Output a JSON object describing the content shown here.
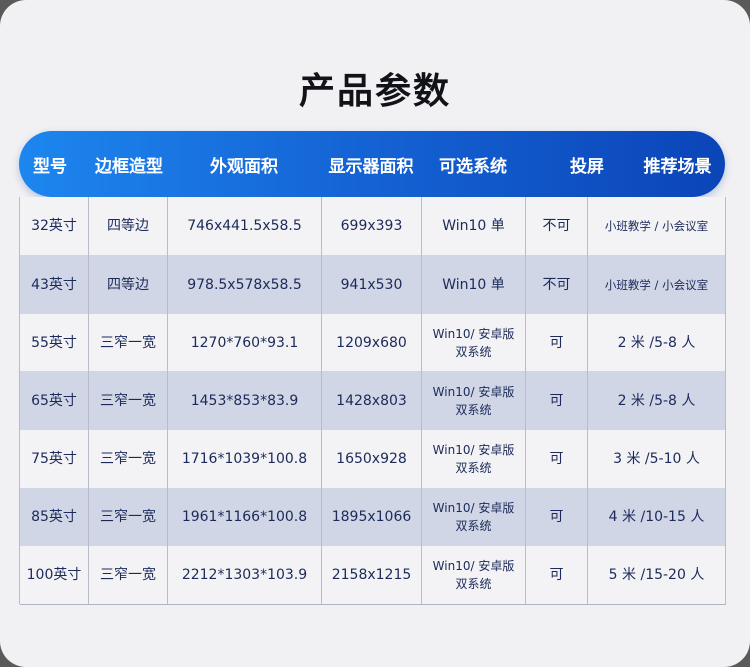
{
  "title": "产品参数",
  "header": {
    "columns": [
      "型号",
      "边框造型",
      "外观面积",
      "显示器面积",
      "可选系统",
      "投屏",
      "推荐场景"
    ],
    "gradient_colors": [
      "#1d86ef",
      "#0b45b8"
    ]
  },
  "colors": {
    "row_alt": "#d0d6e5",
    "row_plain": "#f3f3f5",
    "text": "#1b2a5a"
  },
  "rows": [
    {
      "model": "32英寸",
      "frame": "四等边",
      "exterior": "746x441.5x58.5",
      "display": "699x393",
      "system": "Win10 单",
      "system_line2": "",
      "cast": "不可",
      "scene": "小班教学 / 小会议室"
    },
    {
      "model": "43英寸",
      "frame": "四等边",
      "exterior": "978.5x578x58.5",
      "display": "941x530",
      "system": "Win10 单",
      "system_line2": "",
      "cast": "不可",
      "scene": "小班教学 / 小会议室"
    },
    {
      "model": "55英寸",
      "frame": "三窄一宽",
      "exterior": "1270*760*93.1",
      "display": "1209x680",
      "system": "Win10/ 安卓版",
      "system_line2": "双系统",
      "cast": "可",
      "scene": "2 米 /5-8 人"
    },
    {
      "model": "65英寸",
      "frame": "三窄一宽",
      "exterior": "1453*853*83.9",
      "display": "1428x803",
      "system": "Win10/ 安卓版",
      "system_line2": "双系统",
      "cast": "可",
      "scene": "2 米 /5-8 人"
    },
    {
      "model": "75英寸",
      "frame": "三窄一宽",
      "exterior": "1716*1039*100.8",
      "display": "1650x928",
      "system": "Win10/ 安卓版",
      "system_line2": "双系统",
      "cast": "可",
      "scene": "3 米 /5-10 人"
    },
    {
      "model": "85英寸",
      "frame": "三窄一宽",
      "exterior": "1961*1166*100.8",
      "display": "1895x1066",
      "system": "Win10/ 安卓版",
      "system_line2": "双系统",
      "cast": "可",
      "scene": "4 米 /10-15 人"
    },
    {
      "model": "100英寸",
      "frame": "三窄一宽",
      "exterior": "2212*1303*103.9",
      "display": "2158x1215",
      "system": "Win10/ 安卓版",
      "system_line2": "双系统",
      "cast": "可",
      "scene": "5 米 /15-20 人"
    }
  ]
}
